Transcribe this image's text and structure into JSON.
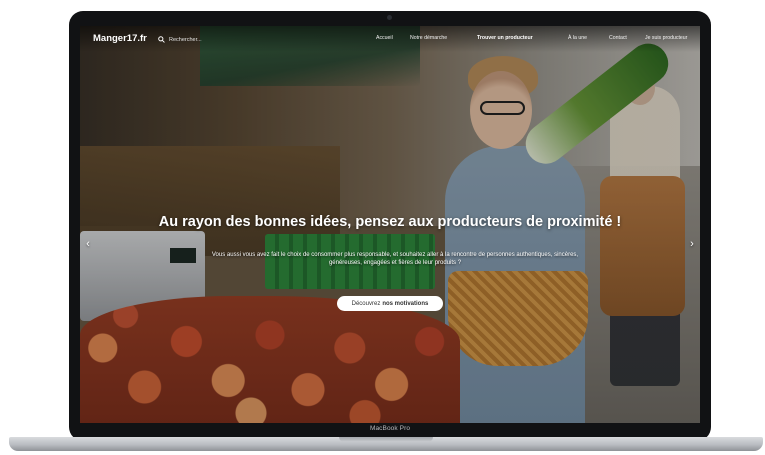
{
  "device": {
    "bezel_label": "MacBook Pro"
  },
  "site": {
    "logo": "Manger17.fr",
    "search_placeholder": "Rechercher...",
    "menu": [
      {
        "label": "Accueil"
      },
      {
        "label": "Notre démarche"
      },
      {
        "label": "Trouver un producteur",
        "active": true
      },
      {
        "label": "À la une"
      },
      {
        "label": "Contact"
      },
      {
        "label": "Je suis producteur"
      }
    ]
  },
  "hero": {
    "title": "Au rayon des bonnes idées, pensez aux producteurs de proximité !",
    "text": "Vous aussi vous avez fait le choix de consommer plus responsable, et souhaitez aller à la rencontre de personnes authentiques, sincères, généreuses, engagées et fières de leur produits ?",
    "cta_prefix": "Découvrez",
    "cta_bold": "nos motivations",
    "arrow_left": "‹",
    "arrow_right": "›"
  },
  "icons": [
    "search-icon",
    "arrow-left-icon",
    "arrow-right-icon",
    "camera-icon"
  ]
}
